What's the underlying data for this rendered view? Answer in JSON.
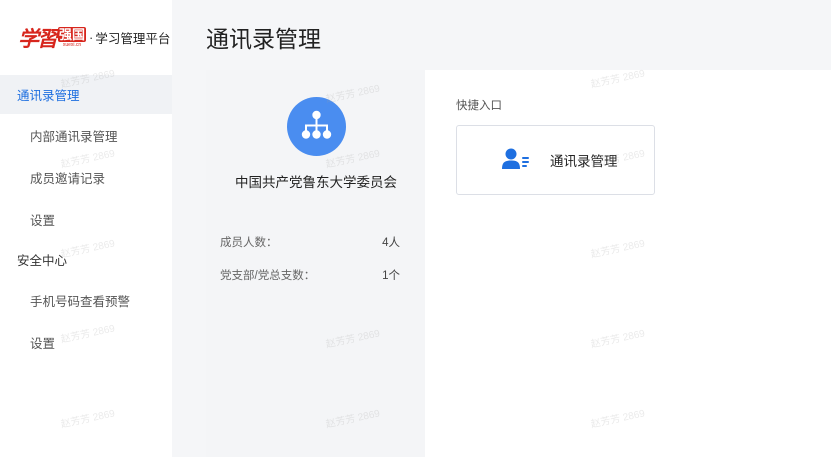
{
  "brand": {
    "logo_mark": "学習",
    "logo_box_main": "强国",
    "logo_box_sub": "xuexi.cn",
    "separator": "·",
    "platform_name": "学习管理平台"
  },
  "sidebar": {
    "groups": [
      {
        "label": "通讯录管理",
        "active": true,
        "items": [
          {
            "label": "内部通讯录管理"
          },
          {
            "label": "成员邀请记录"
          },
          {
            "label": "设置"
          }
        ]
      },
      {
        "label": "安全中心",
        "active": false,
        "items": [
          {
            "label": "手机号码查看预警"
          },
          {
            "label": "设置"
          }
        ]
      }
    ]
  },
  "page": {
    "title": "通讯录管理"
  },
  "org": {
    "icon": "org-structure-icon",
    "name": "中国共产党鲁东大学委员会",
    "stats": [
      {
        "label": "成员人数：",
        "value": "4人"
      },
      {
        "label": "党支部/党总支数：",
        "value": "1个"
      }
    ]
  },
  "quick": {
    "title": "快捷入口",
    "card": {
      "icon": "contacts-icon",
      "label": "通讯录管理"
    }
  },
  "watermark": {
    "text": "赵芳芳 2869"
  },
  "colors": {
    "accent": "#1e6fe0",
    "icon_blue": "#4a8df0",
    "brand_red": "#d7261d",
    "panel_bg": "#f4f5f7"
  }
}
